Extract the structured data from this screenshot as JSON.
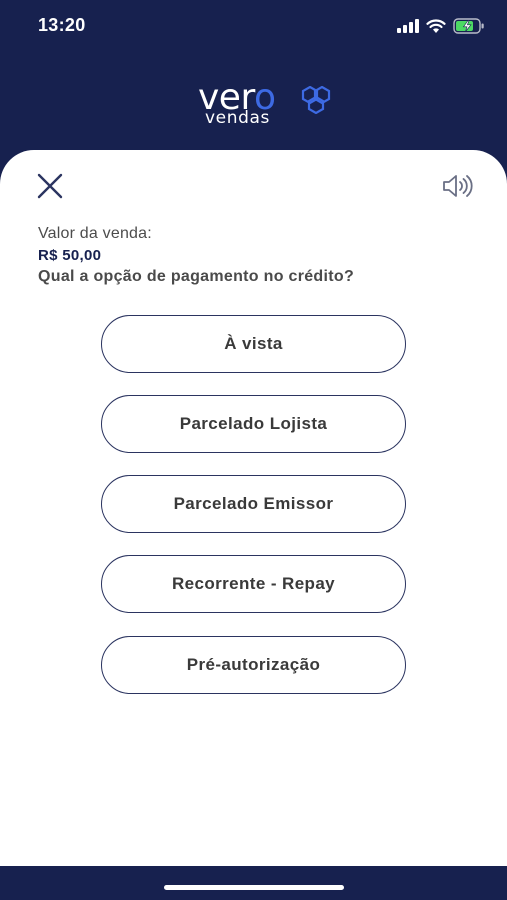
{
  "colors": {
    "navy": "#17214f",
    "accent": "#3d6ae3",
    "battery": "#4cd964"
  },
  "status_bar": {
    "time": "13:20",
    "icons": [
      "cellular-signal-icon",
      "wifi-icon",
      "battery-charging-icon"
    ]
  },
  "brand": {
    "wordmark_start": "ver",
    "wordmark_accent": "o",
    "subtitle": "vendas",
    "logo_icon": "hexagon-cluster-icon"
  },
  "header": {
    "close_icon": "close-icon",
    "sound_icon": "speaker-icon"
  },
  "sale": {
    "label": "Valor da venda:",
    "amount": "R$ 50,00",
    "question": "Qual a opção de pagamento no crédito?"
  },
  "options": [
    {
      "label": "À vista"
    },
    {
      "label": "Parcelado Lojista"
    },
    {
      "label": "Parcelado Emissor"
    },
    {
      "label": "Recorrente - Repay"
    },
    {
      "label": "Pré-autorização"
    }
  ]
}
